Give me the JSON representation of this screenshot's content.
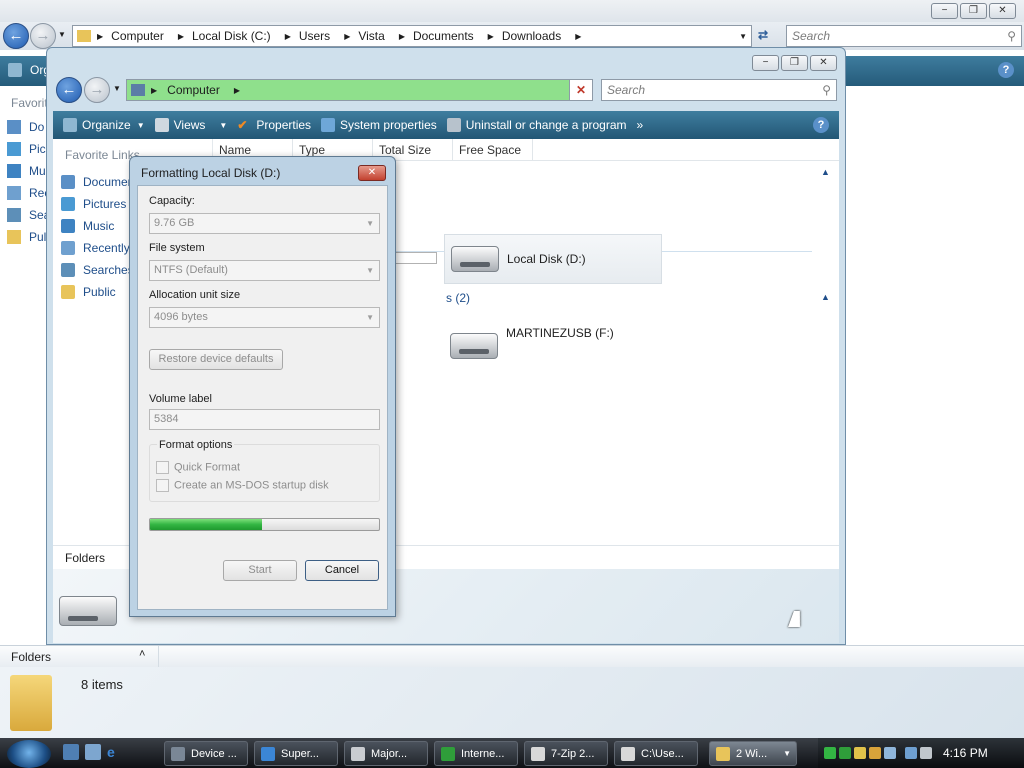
{
  "back_window": {
    "caption_buttons": [
      "−",
      "❐",
      "✕"
    ],
    "breadcrumb": [
      "Computer",
      "Local Disk (C:)",
      "Users",
      "Vista",
      "Documents",
      "Downloads"
    ],
    "search_placeholder": "Search",
    "toolbar_clipped": "Org",
    "left_header_clipped": "Favorit",
    "left_items_clipped": [
      "Do",
      "Pic",
      "Mu",
      "Rec",
      "Sea",
      "Pul"
    ],
    "folders_label": "Folders",
    "status_text": "8 items"
  },
  "front_window": {
    "caption_buttons": [
      "−",
      "❐",
      "✕"
    ],
    "breadcrumb": [
      "Computer"
    ],
    "search_placeholder": "Search",
    "toolbar": {
      "organize": "Organize",
      "views": "Views",
      "properties": "Properties",
      "system_properties": "System properties",
      "uninstall": "Uninstall or change a program",
      "more": "»",
      "help": "?"
    },
    "favorite_links_label": "Favorite Links",
    "favorite_links": [
      "Documents",
      "Pictures",
      "Music",
      "Recently",
      "Searches",
      "Public"
    ],
    "columns": [
      "Name",
      "Type",
      "Total Size",
      "Free Space"
    ],
    "group_count_label": "s (2)",
    "drives": [
      {
        "name": "Local Disk (D:)"
      },
      {
        "name": "MARTINEZUSB (F:)"
      }
    ],
    "folders_label": "Folders"
  },
  "format_dialog": {
    "title": "Formatting Local Disk (D:)",
    "close": "✕",
    "capacity_label": "Capacity:",
    "capacity_value": "9.76 GB",
    "file_system_label": "File system",
    "file_system_value": "NTFS (Default)",
    "allocation_label": "Allocation unit size",
    "allocation_value": "4096 bytes",
    "restore_button": "Restore device defaults",
    "volume_label_label": "Volume label",
    "volume_label_value": "5384",
    "format_options_label": "Format options",
    "quick_format": "Quick Format",
    "msdos_disk": "Create an MS-DOS startup disk",
    "progress_fraction": 0.49,
    "start_button": "Start",
    "cancel_button": "Cancel"
  },
  "taskbar": {
    "tasks": [
      {
        "label": "Device ...",
        "color": "#7a8796"
      },
      {
        "label": "Super...",
        "color": "#3b86d6"
      },
      {
        "label": "Major...",
        "color": "#c9ccd0"
      },
      {
        "label": "Interne...",
        "color": "#2f9e3a"
      },
      {
        "label": "7-Zip 2...",
        "color": "#d8d8d8"
      },
      {
        "label": "C:\\Use...",
        "color": "#d8d8d8"
      },
      {
        "label": "2 Wi...",
        "color": "#e8c45a"
      }
    ],
    "clock": "4:16 PM"
  },
  "colors": {
    "toolbar": "#2c6788",
    "address_highlight": "#8fe08c",
    "progress_fill": "#33b543"
  }
}
